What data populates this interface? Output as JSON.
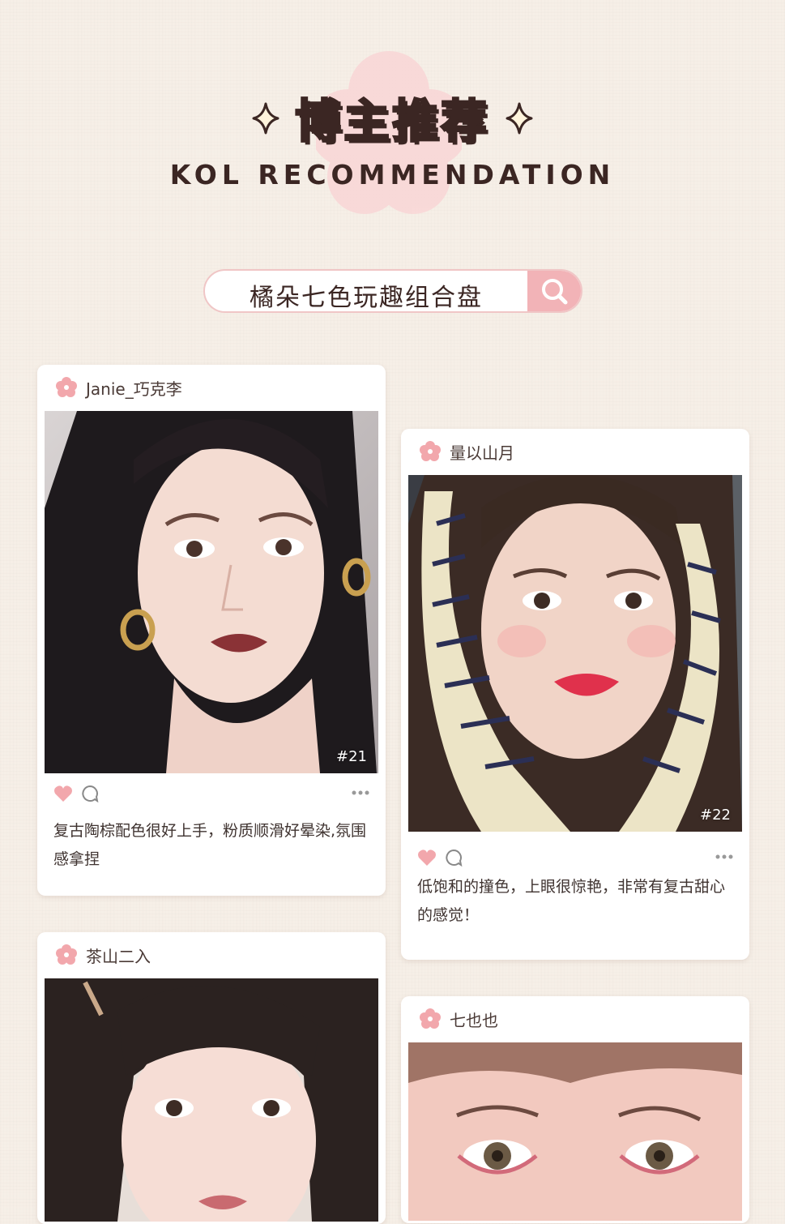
{
  "header": {
    "title_zh": "博主推荐",
    "title_en": "KOL RECOMMENDATION"
  },
  "search": {
    "query": "橘朵七色玩趣组合盘"
  },
  "posts": [
    {
      "author": "Janie_巧克李",
      "tag": "#21",
      "comment": "复古陶棕配色很好上手，粉质顺滑好晕染,氛围感拿捏"
    },
    {
      "author": "量以山月",
      "tag": "#22",
      "comment": "低饱和的撞色，上眼很惊艳，非常有复古甜心的感觉！"
    },
    {
      "author": "茶山二入",
      "tag": "",
      "comment": ""
    },
    {
      "author": "七也也",
      "tag": "",
      "comment": ""
    }
  ],
  "colors": {
    "background": "#f6efe7",
    "accent_pink": "#f2b3b7",
    "text_dark": "#3b2623"
  }
}
